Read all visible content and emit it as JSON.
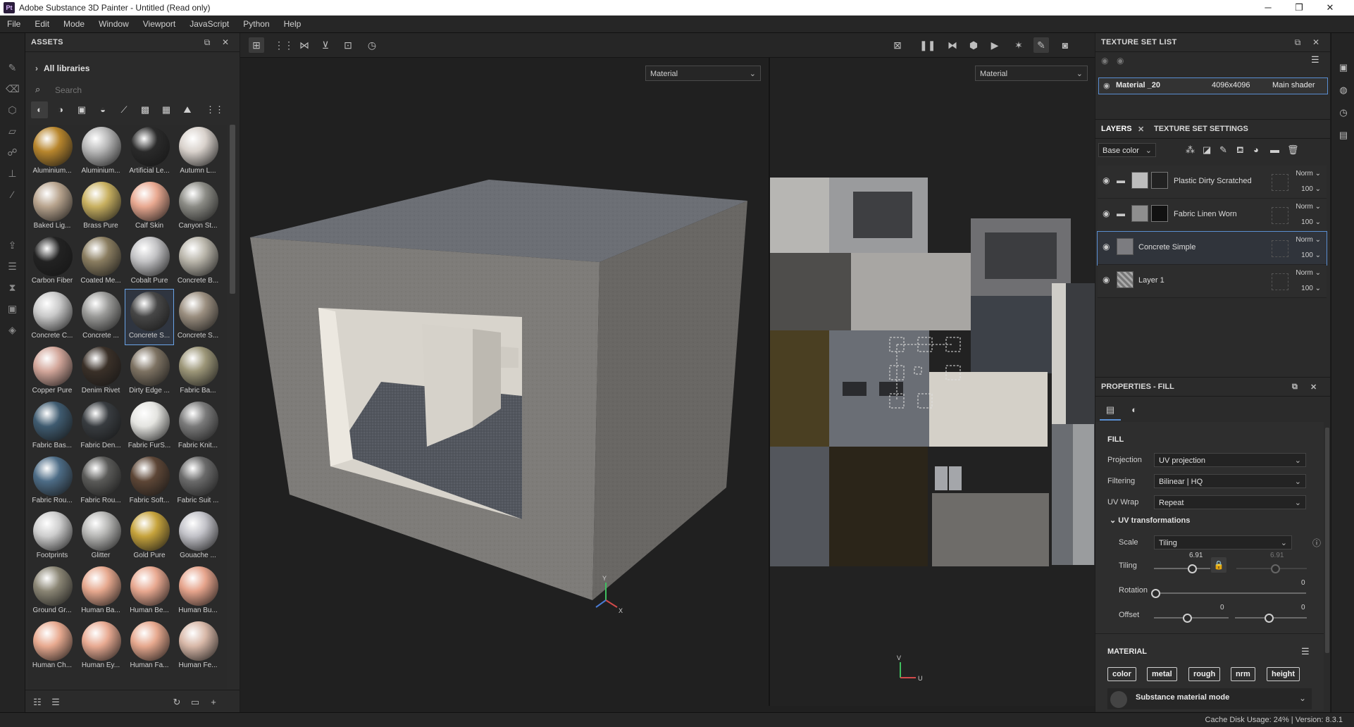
{
  "window": {
    "title": "Adobe Substance 3D Painter - Untitled (Read only)",
    "logo": "Pt",
    "minimize": "─",
    "maximize": "❐",
    "close": "✕"
  },
  "menu": [
    "File",
    "Edit",
    "Mode",
    "Window",
    "Viewport",
    "JavaScript",
    "Python",
    "Help"
  ],
  "assets": {
    "title": "ASSETS",
    "all_libraries": "All libraries",
    "search_placeholder": "Search",
    "items": [
      {
        "label": "Aluminium...",
        "color": "#b8862d"
      },
      {
        "label": "Aluminium...",
        "color": "#b7b7b7"
      },
      {
        "label": "Artificial Le...",
        "color": "#2a2a2a"
      },
      {
        "label": "Autumn L...",
        "color": "#d9d2cc"
      },
      {
        "label": "Baked Lig...",
        "color": "#b8a48e"
      },
      {
        "label": "Brass Pure",
        "color": "#c8b060"
      },
      {
        "label": "Calf Skin",
        "color": "#e8a890"
      },
      {
        "label": "Canyon St...",
        "color": "#8b8b85"
      },
      {
        "label": "Carbon Fiber",
        "color": "#222222"
      },
      {
        "label": "Coated Me...",
        "color": "#8a7d60"
      },
      {
        "label": "Cobalt Pure",
        "color": "#c2c2c4"
      },
      {
        "label": "Concrete B...",
        "color": "#b9b5aa"
      },
      {
        "label": "Concrete C...",
        "color": "#c9c9c9"
      },
      {
        "label": "Concrete ...",
        "color": "#9a9a98"
      },
      {
        "label": "Concrete S...",
        "color": "#474747"
      },
      {
        "label": "Concrete S...",
        "color": "#9b8f80"
      },
      {
        "label": "Copper Pure",
        "color": "#d2a69a"
      },
      {
        "label": "Denim Rivet",
        "color": "#3a3028"
      },
      {
        "label": "Dirty Edge ...",
        "color": "#7d7262"
      },
      {
        "label": "Fabric Ba...",
        "color": "#9c9678"
      },
      {
        "label": "Fabric Bas...",
        "color": "#3f5b70"
      },
      {
        "label": "Fabric Den...",
        "color": "#383c40"
      },
      {
        "label": "Fabric FurS...",
        "color": "#e4e4e0"
      },
      {
        "label": "Fabric Knit...",
        "color": "#7a7a7a"
      },
      {
        "label": "Fabric Rou...",
        "color": "#4d6c86"
      },
      {
        "label": "Fabric Rou...",
        "color": "#5a5a58"
      },
      {
        "label": "Fabric Soft...",
        "color": "#5d4636"
      },
      {
        "label": "Fabric Suit ...",
        "color": "#6a6a6a"
      },
      {
        "label": "Footprints",
        "color": "#cdcdcd"
      },
      {
        "label": "Glitter",
        "color": "#b6b6b4"
      },
      {
        "label": "Gold Pure",
        "color": "#c6a33c"
      },
      {
        "label": "Gouache ...",
        "color": "#c2c2c8"
      },
      {
        "label": "Ground Gr...",
        "color": "#8a8574"
      },
      {
        "label": "Human Ba...",
        "color": "#e6a88e"
      },
      {
        "label": "Human Be...",
        "color": "#e8a890"
      },
      {
        "label": "Human Bu...",
        "color": "#e6a48c"
      },
      {
        "label": "Human Ch...",
        "color": "#e8aa90"
      },
      {
        "label": "Human Ey...",
        "color": "#e8aa92"
      },
      {
        "label": "Human Fa...",
        "color": "#e6a88e"
      },
      {
        "label": "Human Fe...",
        "color": "#d8b8a8"
      }
    ]
  },
  "viewport": {
    "left_channel": "Material",
    "right_channel": "Material",
    "axis_x": "X",
    "axis_y": "Y",
    "axis_u": "U",
    "axis_v": "V"
  },
  "texture_set_list": {
    "title": "TEXTURE SET LIST",
    "name": "Material _20",
    "resolution": "4096x4096",
    "shader": "Main shader"
  },
  "layers": {
    "tab_layers": "LAYERS",
    "tab_tss": "TEXTURE SET SETTINGS",
    "channel": "Base color",
    "items": [
      {
        "name": "Plastic Dirty Scratched",
        "blend": "Norm",
        "opacity": "100"
      },
      {
        "name": "Fabric Linen Worn",
        "blend": "Norm",
        "opacity": "100"
      },
      {
        "name": "Concrete Simple",
        "blend": "Norm",
        "opacity": "100"
      },
      {
        "name": "Layer 1",
        "blend": "Norm",
        "opacity": "100"
      }
    ]
  },
  "properties": {
    "title": "PROPERTIES - FILL",
    "fill_header": "FILL",
    "projection_label": "Projection",
    "projection_value": "UV projection",
    "filtering_label": "Filtering",
    "filtering_value": "Bilinear | HQ",
    "uvwrap_label": "UV Wrap",
    "uvwrap_value": "Repeat",
    "uvt_header": "UV transformations",
    "scale_label": "Scale",
    "scale_value": "Tiling",
    "tiling_label": "Tiling",
    "tiling_u": "6.91",
    "tiling_v": "6.91",
    "rotation_label": "Rotation",
    "rotation_value": "0",
    "offset_label": "Offset",
    "offset_u": "0",
    "offset_v": "0",
    "material_header": "MATERIAL",
    "channels": [
      "color",
      "metal",
      "rough",
      "nrm",
      "height"
    ],
    "mode_label": "Substance material mode"
  },
  "status": {
    "text": "Cache Disk Usage:   24% | Version: 8.3.1"
  }
}
